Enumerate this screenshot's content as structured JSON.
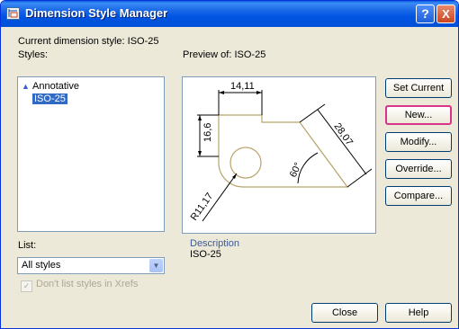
{
  "window": {
    "title": "Dimension Style Manager",
    "help_glyph": "?",
    "close_glyph": "X"
  },
  "current_style": {
    "label": "Current dimension style: ISO-25"
  },
  "styles": {
    "label": "Styles:",
    "items": [
      {
        "label": "Annotative",
        "icon": "annotative-triangle-icon",
        "selected": false
      },
      {
        "label": "ISO-25",
        "selected": true
      }
    ]
  },
  "preview": {
    "label": "Preview of: ISO-25",
    "dimensions": {
      "top": "14,11",
      "left": "16,6",
      "diagonal": "28,07",
      "angle": "60°",
      "radius": "R11,17"
    },
    "line_color": "#b8a36a"
  },
  "description": {
    "label": "Description",
    "value": "ISO-25"
  },
  "list": {
    "label": "List:",
    "selected": "All styles",
    "options": [
      "All styles"
    ]
  },
  "checkbox": {
    "label": "Don't list styles in Xrefs",
    "checked": true,
    "enabled": false
  },
  "buttons": {
    "set_current": "Set Current",
    "new": "New...",
    "modify": "Modify...",
    "override": "Override...",
    "compare": "Compare...",
    "close": "Close",
    "help": "Help"
  }
}
